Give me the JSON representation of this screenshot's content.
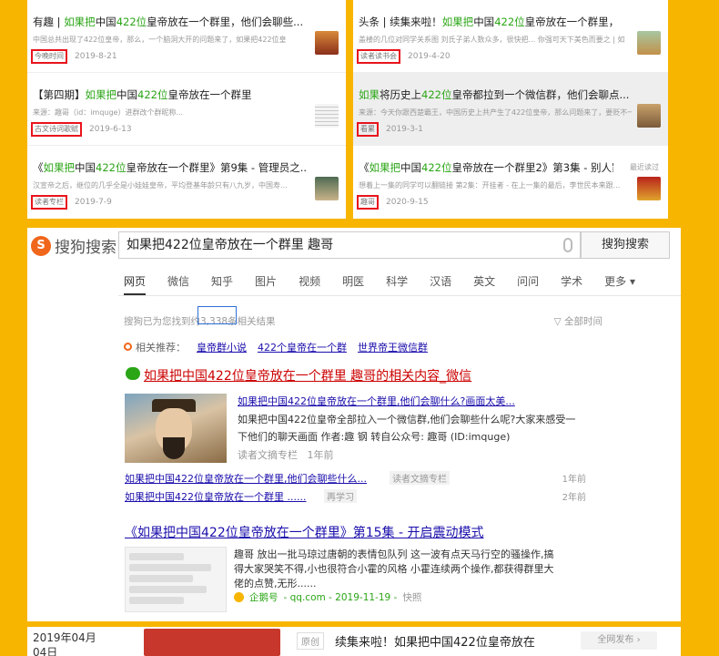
{
  "left_panel": {
    "items": [
      {
        "prefix": "有趣 | ",
        "hl": "如果把",
        "mid": "中国",
        "num": "422位",
        "rest": "皇帝放在一个群里，他们会聊些...",
        "desc": "中国总共出现了422位皇帝，那么，一个脑洞大开的问题来了，如果把422位皇",
        "source": "今晚时间",
        "date": "2019-8-21"
      },
      {
        "prefix": "【第四期】",
        "hl": "如果把",
        "mid": "中国",
        "num": "422位",
        "rest": "皇帝放在一个群里",
        "desc": "来源：趣哥（id：imquge）进群改个群昵称...",
        "source": "古文诗词歌赋",
        "date": "2019-6-13"
      },
      {
        "prefix": "《",
        "hl": "如果把",
        "mid": "中国",
        "num": "422位",
        "rest": "皇帝放在一个群里》第9集 - 管理员之...",
        "desc": "汉宣帝之后，继位的几乎全是小娃娃皇帝，平均登基年龄只有八九岁，中国寿...",
        "source": "读者专栏",
        "date": "2019-7-9"
      }
    ]
  },
  "right_panel": {
    "items": [
      {
        "prefix": "头条 | 续集来啦！",
        "hl": "如果把",
        "mid": "中国",
        "num": "422位",
        "rest": "皇帝放在一个群里，",
        "desc": "盖楼的几位对同学关系图 刘氏子弟人数众多，很快把... 你强可天下美色而要之 | 如",
        "source": "读者读书会",
        "date": "2019-4-20",
        "tag": ""
      },
      {
        "prefix": "",
        "hl": "如果",
        "mid": "将历史上",
        "num": "422位",
        "rest": "皇帝都拉到一个微信群，他们会聊点...",
        "desc": "来源：今天你跟西楚霸王，中国历史上共产生了422位皇帝，那么问题来了，要贬不一...",
        "source": "看累",
        "date": "2019-3-1",
        "tag": ""
      },
      {
        "prefix": "《",
        "hl": "如果把",
        "mid": "中国",
        "num": "422位",
        "rest": "皇帝放在一个群里2》第3集 - 别人家...",
        "desc": "想着上一集的同学可以翻链接 第2集：开挂者 - 在上一集的最后，李世民本来跟...",
        "source": "趣哥",
        "date": "2020-9-15",
        "tag": "最近读过"
      }
    ]
  },
  "sogou": {
    "logo_mark": "S",
    "logo_text": "搜狗搜索",
    "query": "如果把422位皇帝放在一个群里  趣哥",
    "search_button": "搜狗搜索",
    "tabs": [
      "网页",
      "微信",
      "知乎",
      "图片",
      "视频",
      "明医",
      "科学",
      "汉语",
      "英文",
      "问问",
      "学术",
      "更多 ▾"
    ],
    "count_text": "搜狗已为您找到约3,338条相关结果",
    "all_time": "▽ 全部时间",
    "related_label": "相关推荐：",
    "related": [
      "皇帝群小说",
      "422个皇帝在一个群",
      "世界帝王微信群"
    ],
    "result1": {
      "title": "如果把中国422位皇帝放在一个群里 趣哥的相关内容_微信",
      "sub_title": "如果把中国422位皇帝放在一个群里,他们会聊什么?画面太美...",
      "snippet_1": "如果把中国422位皇帝全部拉入一个微信群,他们会聊些什么呢?大家来感受一",
      "snippet_2": "下他们的聊天画面 作者:趣 钢 转自公众号: 趣哥 (ID:imquge)",
      "source": "读者文摘专栏",
      "age": "1年前",
      "sub_links": [
        {
          "text": "如果把中国422位皇帝放在一个群里,他们会聊些什么...",
          "src": "读者文摘专栏",
          "age": "1年前"
        },
        {
          "text": "如果把中国422位皇帝放在一个群里 ......",
          "src": "再学习",
          "age": "2年前"
        }
      ]
    },
    "result2": {
      "title": "《如果把中国422位皇帝放在一个群里》第15集 - 开启震动模式",
      "line1": "趣哥 放出一批马琼过唐朝的表情包队列 这一波有点天马行空的骚操作,搞",
      "line2": "得大家哭笑不得,小也很符合小霍的风格 小霍连续两个操作,都获得群里大",
      "line3": "佬的点赞,无形......",
      "source_name": "企鹅号",
      "footer": "- qq.com - 2019-11-19 -",
      "snapshot": "快照"
    }
  },
  "bottom_strip": {
    "date": "2019年04月04日",
    "original": "原创",
    "title": "续集来啦！如果把中国422位皇帝放在",
    "publish": "全网发布  ›"
  },
  "colors": {
    "background": "#F7B500",
    "highlight_green": "#2aa515",
    "highlight_red": "#e8141d",
    "link": "#1a0dab",
    "box_blue": "#2e6ed6"
  }
}
